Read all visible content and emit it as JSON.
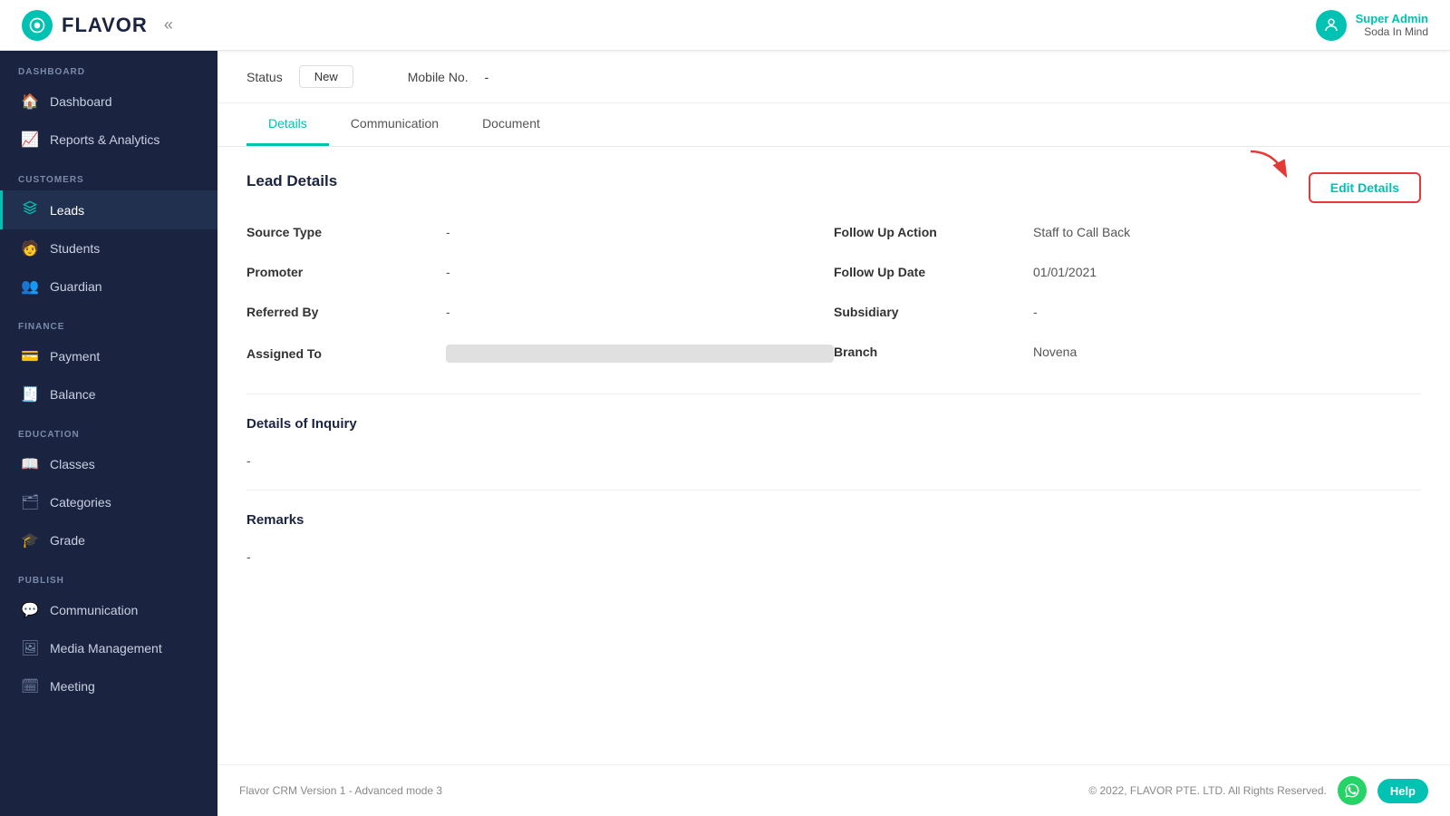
{
  "app": {
    "logo_text": "FLAVOR",
    "collapse_label": "«"
  },
  "user": {
    "name": "Super Admin",
    "org": "Soda In Mind"
  },
  "sidebar": {
    "sections": [
      {
        "label": "DASHBOARD",
        "items": [
          {
            "id": "dashboard",
            "label": "Dashboard",
            "icon": "🏠"
          },
          {
            "id": "reports",
            "label": "Reports & Analytics",
            "icon": "📈"
          }
        ]
      },
      {
        "label": "CUSTOMERS",
        "items": [
          {
            "id": "leads",
            "label": "Leads",
            "icon": "⬆",
            "active": true
          },
          {
            "id": "students",
            "label": "Students",
            "icon": "🧑‍🎓"
          },
          {
            "id": "guardian",
            "label": "Guardian",
            "icon": "👥"
          }
        ]
      },
      {
        "label": "FINANCE",
        "items": [
          {
            "id": "payment",
            "label": "Payment",
            "icon": "💳"
          },
          {
            "id": "balance",
            "label": "Balance",
            "icon": "🧾"
          }
        ]
      },
      {
        "label": "EDUCATION",
        "items": [
          {
            "id": "classes",
            "label": "Classes",
            "icon": "📖"
          },
          {
            "id": "categories",
            "label": "Categories",
            "icon": "🗂"
          },
          {
            "id": "grade",
            "label": "Grade",
            "icon": "🎓"
          }
        ]
      },
      {
        "label": "PUBLISH",
        "items": [
          {
            "id": "communication",
            "label": "Communication",
            "icon": "💬"
          },
          {
            "id": "media",
            "label": "Media Management",
            "icon": "🖼"
          },
          {
            "id": "meeting",
            "label": "Meeting",
            "icon": "🗓"
          }
        ]
      }
    ]
  },
  "main": {
    "status_label": "Status",
    "status_value": "New",
    "mobile_label": "Mobile No.",
    "mobile_value": "-",
    "tabs": [
      {
        "id": "details",
        "label": "Details",
        "active": true
      },
      {
        "id": "communication",
        "label": "Communication"
      },
      {
        "id": "document",
        "label": "Document"
      }
    ],
    "lead_details": {
      "section_title": "Lead Details",
      "edit_button_label": "Edit Details",
      "fields_left": [
        {
          "label": "Source Type",
          "value": "-"
        },
        {
          "label": "Promoter",
          "value": "-"
        },
        {
          "label": "Referred By",
          "value": "-"
        },
        {
          "label": "Assigned To",
          "value": "██████"
        }
      ],
      "fields_right": [
        {
          "label": "Follow Up Action",
          "value": "Staff to Call Back"
        },
        {
          "label": "Follow Up Date",
          "value": "01/01/2021"
        },
        {
          "label": "Subsidiary",
          "value": "-"
        },
        {
          "label": "Branch",
          "value": "Novena"
        }
      ]
    },
    "inquiry": {
      "title": "Details of Inquiry",
      "value": "-"
    },
    "remarks": {
      "title": "Remarks",
      "value": "-"
    }
  },
  "footer": {
    "version_text": "Flavor CRM Version 1 - Advanced mode 3",
    "copyright": "© 2022, FLAVOR PTE. LTD. All Rights Reserved.",
    "help_label": "Help"
  }
}
